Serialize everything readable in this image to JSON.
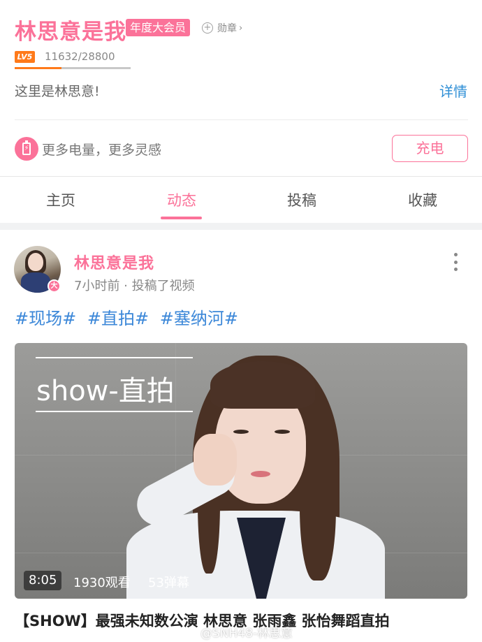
{
  "profile": {
    "username": "林思意是我",
    "vip_badge": "年度大会员",
    "medal_label": "勋章",
    "level_label": "LV5",
    "exp_text": "11632/28800",
    "exp_progress": 0.404,
    "bio": "这里是林思意!",
    "detail_link": "详情",
    "charge_text": "更多电量，更多灵感",
    "charge_button": "充电"
  },
  "tabs": [
    {
      "label": "主页",
      "active": false
    },
    {
      "label": "动态",
      "active": true
    },
    {
      "label": "投稿",
      "active": false
    },
    {
      "label": "收藏",
      "active": false
    }
  ],
  "post": {
    "avatar_badge": "大",
    "author": "林思意是我",
    "meta": "7小时前 · 投稿了视频",
    "tags": [
      "#现场#",
      "#直拍#",
      "#塞纳河#"
    ],
    "video": {
      "overlay_title": "show-直拍",
      "duration": "8:05",
      "views": "1930观看",
      "danmaku": "53弹幕",
      "title": "【SHOW】最强未知数公演 林思意 张雨鑫 张怡舞蹈直拍"
    }
  },
  "watermark": "@SNH48-林思意",
  "colors": {
    "accent_pink": "#fb7299",
    "link_blue": "#2f8fd6",
    "tag_blue": "#3b87d8",
    "level_orange": "#ff7a1a"
  },
  "icons": {
    "medal": "plus-circle-icon",
    "charge": "battery-bolt-icon",
    "more": "more-vertical-icon"
  }
}
